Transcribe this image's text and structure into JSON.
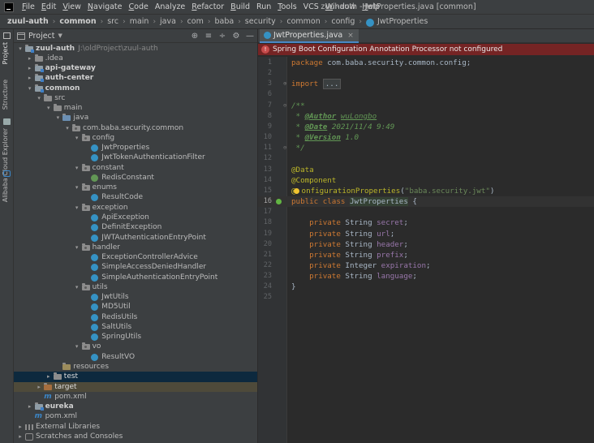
{
  "menu": {
    "items": [
      {
        "label": "File",
        "u": "F",
        "rest": "ile"
      },
      {
        "label": "Edit",
        "u": "E",
        "rest": "dit"
      },
      {
        "label": "View",
        "u": "V",
        "rest": "iew"
      },
      {
        "label": "Navigate",
        "u": "N",
        "rest": "avigate"
      },
      {
        "label": "Code",
        "u": "C",
        "rest": "ode"
      },
      {
        "label": "Analyze",
        "u": "",
        "rest": "Analyze"
      },
      {
        "label": "Refactor",
        "u": "R",
        "rest": "efactor"
      },
      {
        "label": "Build",
        "u": "B",
        "rest": "uild"
      },
      {
        "label": "Run",
        "u": "",
        "rest": "Run"
      },
      {
        "label": "Tools",
        "u": "T",
        "rest": "ools"
      },
      {
        "label": "VCS",
        "u": "",
        "rest": "VCS"
      },
      {
        "label": "Window",
        "u": "W",
        "rest": "indow"
      },
      {
        "label": "Help",
        "u": "H",
        "rest": "elp"
      }
    ],
    "window_title": "zuul-auth - JwtProperties.java [common]"
  },
  "breadcrumb": [
    "zuul-auth",
    "common",
    "src",
    "main",
    "java",
    "com",
    "baba",
    "security",
    "common",
    "config",
    "JwtProperties"
  ],
  "left_stripe": {
    "project": "Project",
    "structure": "Structure",
    "alibaba": "Alibaba Cloud Explorer"
  },
  "project_panel": {
    "title": "Project",
    "tree": [
      {
        "d": 0,
        "a": "▾",
        "i": "mod",
        "t": "zuul-auth",
        "b": true,
        "p": "J:\\oldProject\\zuul-auth"
      },
      {
        "d": 1,
        "a": "▸",
        "i": "folder",
        "t": ".idea"
      },
      {
        "d": 1,
        "a": "▸",
        "i": "mod",
        "t": "api-gateway",
        "b": true
      },
      {
        "d": 1,
        "a": "▸",
        "i": "mod",
        "t": "auth-center",
        "b": true
      },
      {
        "d": 1,
        "a": "▾",
        "i": "mod",
        "t": "common",
        "b": true
      },
      {
        "d": 2,
        "a": "▾",
        "i": "folder",
        "t": "src"
      },
      {
        "d": 3,
        "a": "▾",
        "i": "folder",
        "t": "main"
      },
      {
        "d": 4,
        "a": "▾",
        "i": "src",
        "t": "java"
      },
      {
        "d": 5,
        "a": "▾",
        "i": "pkg",
        "t": "com.baba.security.common"
      },
      {
        "d": 6,
        "a": "▾",
        "i": "pkg",
        "t": "config"
      },
      {
        "d": 7,
        "a": "",
        "i": "cls",
        "t": "JwtProperties"
      },
      {
        "d": 7,
        "a": "",
        "i": "cls",
        "t": "JwtTokenAuthenticationFilter"
      },
      {
        "d": 6,
        "a": "▾",
        "i": "pkg",
        "t": "constant"
      },
      {
        "d": 7,
        "a": "",
        "i": "ifc",
        "t": "RedisConstant"
      },
      {
        "d": 6,
        "a": "▾",
        "i": "pkg",
        "t": "enums"
      },
      {
        "d": 7,
        "a": "",
        "i": "cls",
        "t": "ResultCode"
      },
      {
        "d": 6,
        "a": "▾",
        "i": "pkg",
        "t": "exception"
      },
      {
        "d": 7,
        "a": "",
        "i": "cls",
        "t": "ApiException"
      },
      {
        "d": 7,
        "a": "",
        "i": "cls",
        "t": "DefinitException"
      },
      {
        "d": 7,
        "a": "",
        "i": "cls",
        "t": "JWTAuthenticationEntryPoint"
      },
      {
        "d": 6,
        "a": "▾",
        "i": "pkg",
        "t": "handler"
      },
      {
        "d": 7,
        "a": "",
        "i": "cls",
        "t": "ExceptionControllerAdvice"
      },
      {
        "d": 7,
        "a": "",
        "i": "cls",
        "t": "SimpleAccessDeniedHandler"
      },
      {
        "d": 7,
        "a": "",
        "i": "cls",
        "t": "SimpleAuthenticationEntryPoint"
      },
      {
        "d": 6,
        "a": "▾",
        "i": "pkg",
        "t": "utils"
      },
      {
        "d": 7,
        "a": "",
        "i": "cls",
        "t": "JwtUtils"
      },
      {
        "d": 7,
        "a": "",
        "i": "cls",
        "t": "MD5Util"
      },
      {
        "d": 7,
        "a": "",
        "i": "cls",
        "t": "RedisUtils"
      },
      {
        "d": 7,
        "a": "",
        "i": "cls",
        "t": "SaltUtils"
      },
      {
        "d": 7,
        "a": "",
        "i": "cls",
        "t": "SpringUtils"
      },
      {
        "d": 6,
        "a": "▾",
        "i": "pkg",
        "t": "vo"
      },
      {
        "d": 7,
        "a": "",
        "i": "cls",
        "t": "ResultVO"
      },
      {
        "d": 4,
        "a": "",
        "i": "res",
        "t": "resources"
      },
      {
        "d": 3,
        "a": "▸",
        "i": "folder",
        "t": "test",
        "s": "sel"
      },
      {
        "d": 2,
        "a": "▸",
        "i": "excl",
        "t": "target",
        "s": "sel2"
      },
      {
        "d": 2,
        "a": "",
        "i": "mvn",
        "t": "pom.xml"
      },
      {
        "d": 1,
        "a": "▸",
        "i": "mod",
        "t": "eureka",
        "b": true
      },
      {
        "d": 1,
        "a": "",
        "i": "mvn",
        "t": "pom.xml"
      },
      {
        "d": 0,
        "a": "▸",
        "i": "libs",
        "t": "External Libraries"
      },
      {
        "d": 0,
        "a": "▸",
        "i": "scr",
        "t": "Scratches and Consoles"
      }
    ]
  },
  "editor": {
    "tab_label": "JwtProperties.java",
    "banner": "Spring Boot Configuration Annotation Processor not configured",
    "lines": [
      {
        "n": "1",
        "h": "<span class=\"kw\">package</span> com.baba.security.common.config;"
      },
      {
        "n": "2",
        "h": ""
      },
      {
        "n": "3",
        "h": "<span class=\"kw\">import</span> <span class=\"fold-txt\">...</span>",
        "f": "⊕"
      },
      {
        "n": "6",
        "h": ""
      },
      {
        "n": "7",
        "h": "<span class=\"cmt\">/**</span>",
        "f": "⊖"
      },
      {
        "n": "8",
        "h": "<span class=\"cmt\"> * </span><span class=\"tag\">@Author</span><span class=\"cmt\"> </span><span class=\"cmt\" style=\"text-decoration:underline\">wuLongbo</span>"
      },
      {
        "n": "9",
        "h": "<span class=\"cmt\"> * </span><span class=\"tag\">@Date</span><span class=\"cmt\"> 2021/11/4 9:49</span>"
      },
      {
        "n": "10",
        "h": "<span class=\"cmt\"> * </span><span class=\"tag\">@Version</span><span class=\"cmt\"> 1.0</span>"
      },
      {
        "n": "11",
        "h": "<span class=\"cmt\"> */</span>",
        "f": "⊖"
      },
      {
        "n": "12",
        "h": ""
      },
      {
        "n": "13",
        "h": "<span class=\"ann\">@Data</span>"
      },
      {
        "n": "14",
        "h": "<span class=\"ann\">@Component</span>"
      },
      {
        "n": "15",
        "h": "<span class=\"ann\">@</span><span class=\"bulb\"></span><span class=\"ann\">onfigurationProperties</span>(<span class=\"str\">\"baba.security.jwt\"</span>)"
      },
      {
        "n": "16",
        "h": "<span class=\"kw\">public class</span> <span class=\"cls-name\">JwtProperties</span> {",
        "cur": true,
        "bean": true
      },
      {
        "n": "17",
        "h": ""
      },
      {
        "n": "18",
        "h": "    <span class=\"kw\">private</span> String <span class=\"fld\">secret</span>;"
      },
      {
        "n": "19",
        "h": "    <span class=\"kw\">private</span> String <span class=\"fld\">url</span>;"
      },
      {
        "n": "20",
        "h": "    <span class=\"kw\">private</span> String <span class=\"fld\">header</span>;"
      },
      {
        "n": "21",
        "h": "    <span class=\"kw\">private</span> String <span class=\"fld\">prefix</span>;"
      },
      {
        "n": "22",
        "h": "    <span class=\"kw\">private</span> Integer <span class=\"fld\">expiration</span>;"
      },
      {
        "n": "23",
        "h": "    <span class=\"kw\">private</span> String <span class=\"fld\">language</span>;"
      },
      {
        "n": "24",
        "h": "}"
      },
      {
        "n": "25",
        "h": ""
      }
    ]
  }
}
